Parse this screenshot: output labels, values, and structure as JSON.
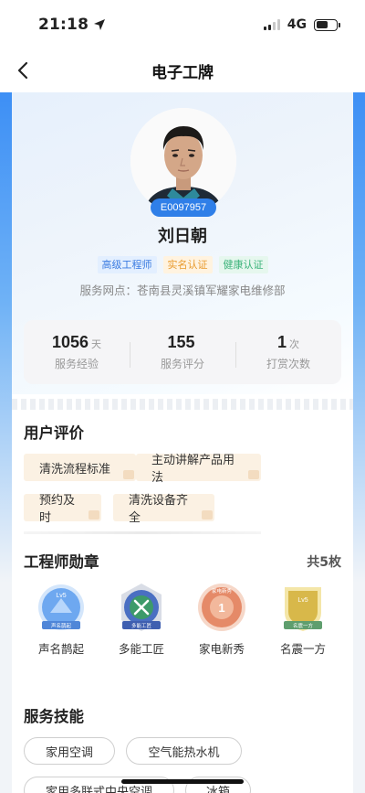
{
  "status_bar": {
    "time": "21:18",
    "network": "4G",
    "location_icon": "location-arrow-icon"
  },
  "nav": {
    "title": "电子工牌",
    "back_icon": "chevron-left-icon"
  },
  "profile": {
    "employee_id": "E0097957",
    "name": "刘日朝",
    "tags": [
      "高级工程师",
      "实名认证",
      "健康认证"
    ],
    "outlet": "服务网点：苍南县灵溪镇军耀家电维修部"
  },
  "stats": [
    {
      "value": "1056",
      "unit": "天",
      "label": "服务经验"
    },
    {
      "value": "155",
      "unit": "",
      "label": "服务评分"
    },
    {
      "value": "1",
      "unit": "次",
      "label": "打赏次数"
    }
  ],
  "reviews": {
    "title": "用户评价",
    "items": [
      "清洗流程标准",
      "主动讲解产品用法",
      "预约及时",
      "清洗设备齐全"
    ]
  },
  "badges": {
    "title": "工程师勋章",
    "count_text": "共5枚",
    "items": [
      {
        "name": "声名鹊起",
        "ribbon": "声名鹊起",
        "level": "Lv5",
        "color": "#6ea8f0"
      },
      {
        "name": "多能工匠",
        "ribbon": "多能工匠",
        "level": "",
        "color": "#5a78c8"
      },
      {
        "name": "家电新秀",
        "ribbon": "家电新秀",
        "level": "1",
        "color": "#e58a68"
      },
      {
        "name": "名震一方",
        "ribbon": "名震一方",
        "level": "Lv5",
        "color": "#d8b84a"
      }
    ]
  },
  "skills": {
    "title": "服务技能",
    "items": [
      "家用空调",
      "空气能热水机",
      "家用多联式中央空调",
      "冰箱"
    ]
  },
  "colors": {
    "accent": "#2f7fe8",
    "chip_bg": "#fbf1e3",
    "page_strip": "#3d8ff5"
  }
}
